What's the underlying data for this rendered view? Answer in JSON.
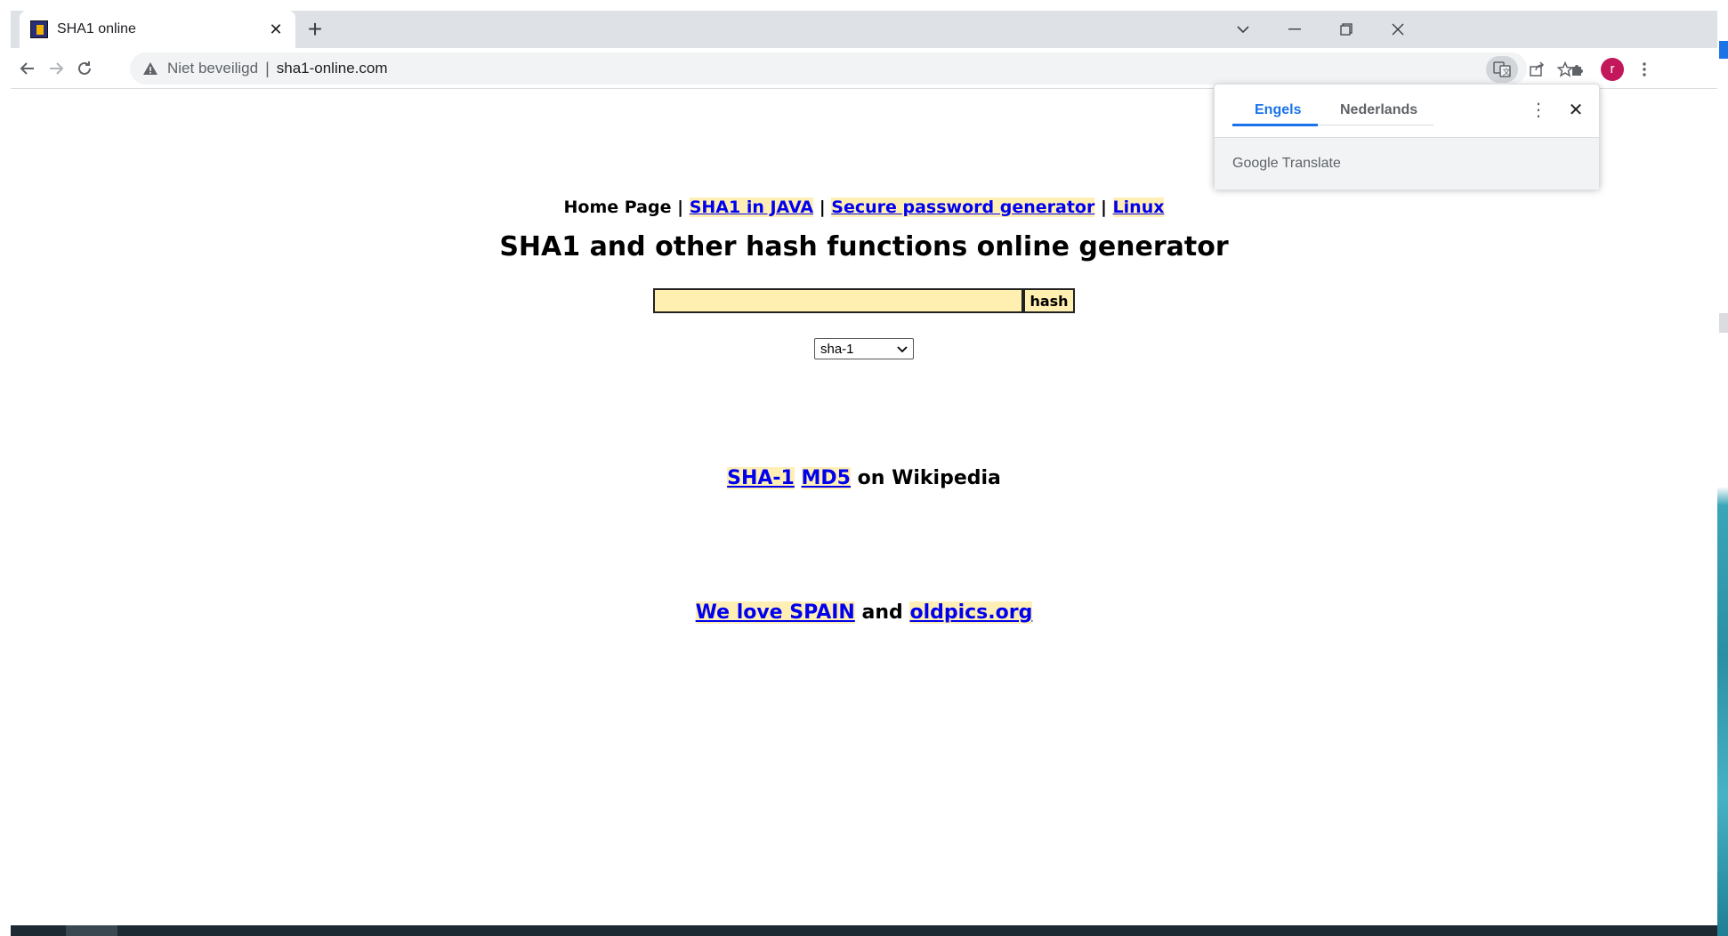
{
  "browser": {
    "tab_title": "SHA1 online",
    "new_tab_symbol": "+",
    "security_label": "Niet beveiligd",
    "separator": "|",
    "url": "sha1-online.com",
    "avatar_initial": "r",
    "icons": [
      "back-icon",
      "forward-icon",
      "reload-icon",
      "warning-icon",
      "translate-icon",
      "share-icon",
      "star-icon",
      "extensions-icon",
      "kebab-menu-icon"
    ]
  },
  "page": {
    "nav": {
      "home": "Home Page",
      "sep": "|",
      "link1": "SHA1 in JAVA",
      "link2": "Secure password generator",
      "link3": "Linux"
    },
    "heading": "SHA1 and other hash functions online generator",
    "hash_input_value": "",
    "hash_button": "hash",
    "algorithm_selected": "sha-1",
    "wiki": {
      "link1": "SHA-1",
      "link2": "MD5",
      "suffix": "on Wikipedia"
    },
    "footer": {
      "link1": "We love SPAIN",
      "joiner": "and",
      "link2": "oldpics.org"
    }
  },
  "translate_popup": {
    "tab_active": "Engels",
    "tab_other": "Nederlands",
    "brand": "Google Translate"
  },
  "colors": {
    "link": "#0000ee",
    "link_bg": "#ffefb5",
    "input_bg": "#ffefb0",
    "chrome_tabstrip": "#dee1e6",
    "translate_accent": "#1a73e8"
  }
}
